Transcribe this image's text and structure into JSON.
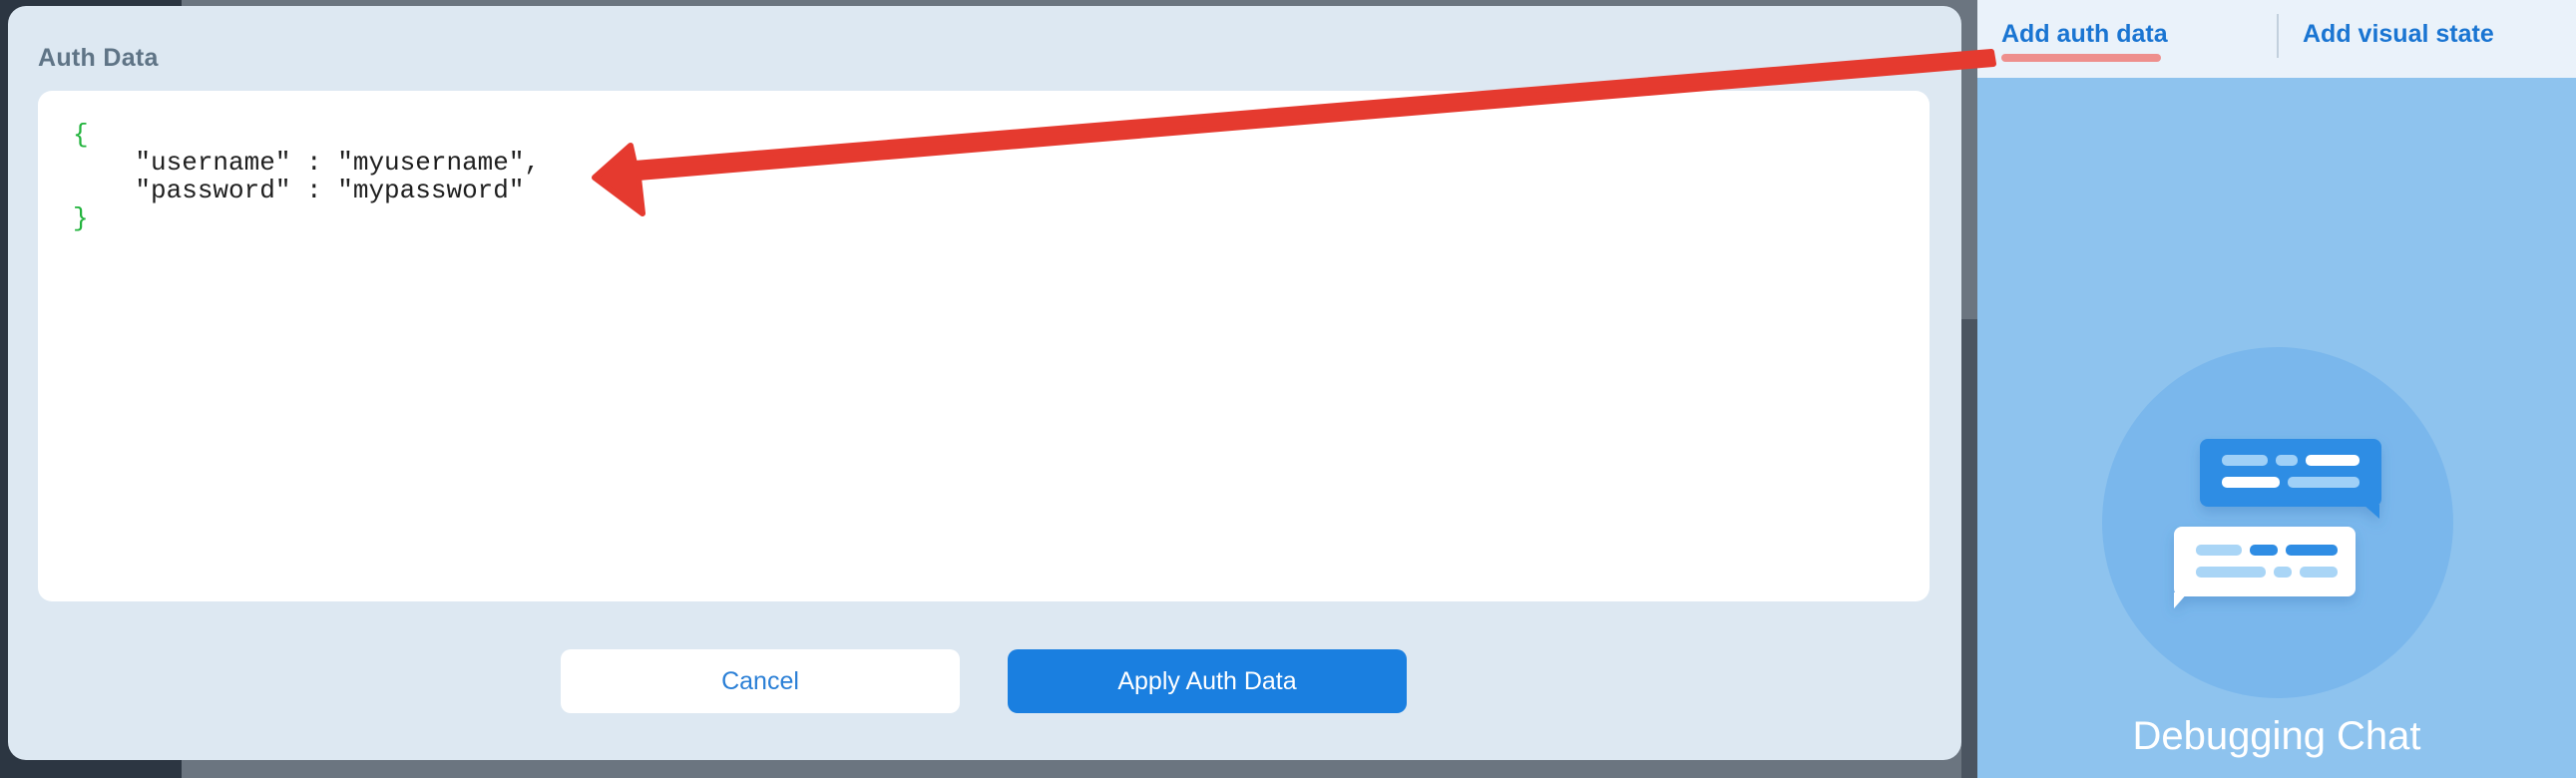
{
  "modal": {
    "title": "Auth Data",
    "code_lines": {
      "open_brace": "{",
      "line_username": "    \"username\" : \"myusername\",",
      "line_password": "    \"password\" : \"mypassword\"",
      "close_brace": "}"
    },
    "cancel_label": "Cancel",
    "apply_label": "Apply Auth Data"
  },
  "right_panel": {
    "tabs": [
      {
        "label": "Add auth data",
        "active": true
      },
      {
        "label": "Add visual state",
        "active": false
      }
    ],
    "empty_state_title": "Debugging Chat",
    "empty_state_icon": "chat-bubbles-icon"
  },
  "colors": {
    "accent": "#1a7fe0",
    "highlight_underline": "#ee8f8d",
    "annotation_arrow": "#e53a2f",
    "brace_green": "#21b33c"
  }
}
